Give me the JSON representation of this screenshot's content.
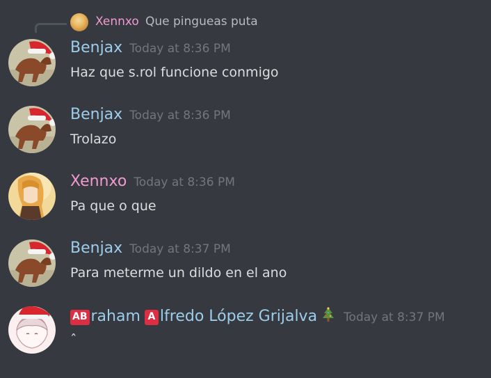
{
  "reply": {
    "author": "Xennxo",
    "text": "Que pingueas puta"
  },
  "messages": [
    {
      "author": "Benjax",
      "author_color": "#9ccdeb",
      "avatar": "horse-santa-hat-avatar",
      "timestamp": "Today at 8:36 PM",
      "content": "Haz que s.rol funcione conmigo"
    },
    {
      "author": "Benjax",
      "author_color": "#9ccdeb",
      "avatar": "horse-santa-hat-avatar",
      "timestamp": "Today at 8:36 PM",
      "content": "Trolazo"
    },
    {
      "author": "Xennxo",
      "author_color": "#f09ad2",
      "avatar": "anime-girl-avatar",
      "timestamp": "Today at 8:36 PM",
      "content": "Pa que o que"
    },
    {
      "author": "Benjax",
      "author_color": "#9ccdeb",
      "avatar": "horse-santa-hat-avatar",
      "timestamp": "Today at 8:37 PM",
      "content": "Para meterme un dildo en el ano"
    },
    {
      "author_emoji_1": "AB",
      "author_part_1": "raham",
      "author_emoji_2": "A",
      "author_part_2": "lfredo López Grijalva",
      "author_color": "#9ccdeb",
      "author_suffix_icon": "christmas-tree-icon",
      "avatar": "anime-boy-santa-hat-avatar",
      "timestamp": "Today at 8:37 PM",
      "content": "ˆ"
    }
  ],
  "colors": {
    "background": "#36393f",
    "text": "#dcddde",
    "timestamp": "#72767d",
    "blue_name": "#9ccdeb",
    "pink_name": "#f09ad2",
    "emoji_red": "#dd2e44"
  }
}
